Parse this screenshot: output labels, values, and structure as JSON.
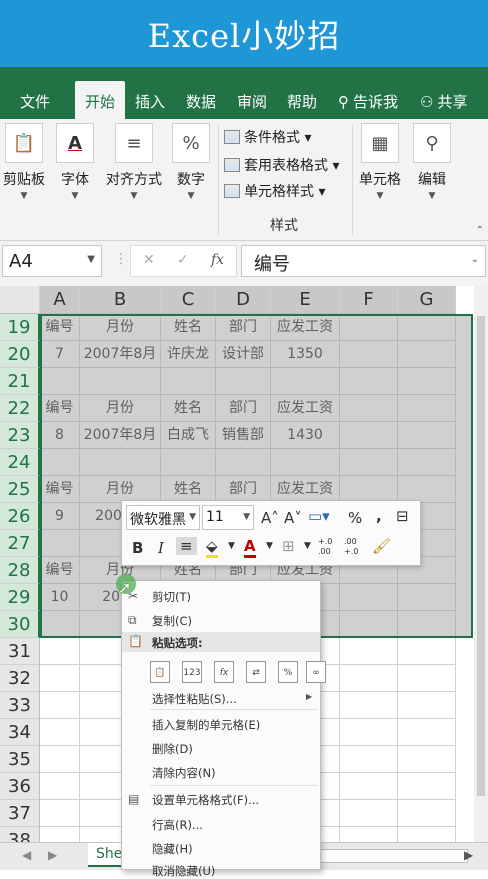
{
  "banner": {
    "title": "Excel小妙招"
  },
  "tabs": [
    {
      "label": "文件",
      "active": false
    },
    {
      "label": "开始",
      "active": true
    },
    {
      "label": "插入",
      "active": false
    },
    {
      "label": "数据",
      "active": false
    },
    {
      "label": "审阅",
      "active": false
    },
    {
      "label": "帮助",
      "active": false
    },
    {
      "label": "告诉我",
      "active": false,
      "icon": "search-icon"
    },
    {
      "label": "共享",
      "active": false,
      "icon": "person-icon"
    }
  ],
  "ribbon": {
    "clipboard": "剪贴板",
    "font": "字体",
    "alignment": "对齐方式",
    "number": "数字",
    "conditional_format": "条件格式",
    "table_format": "套用表格格式",
    "cell_styles": "单元格样式",
    "styles_group": "样式",
    "cells": "单元格",
    "editing": "编辑",
    "number_symbol": "%"
  },
  "formula_bar": {
    "name_box": "A4",
    "content": "编号",
    "fx": "fx"
  },
  "columns": [
    "A",
    "B",
    "C",
    "D",
    "E",
    "F",
    "G"
  ],
  "rows": [
    {
      "num": "19",
      "cells": [
        "编号",
        "月份",
        "姓名",
        "部门",
        "应发工资",
        "",
        ""
      ]
    },
    {
      "num": "20",
      "cells": [
        "7",
        "2007年8月",
        "许庆龙",
        "设计部",
        "1350",
        "",
        ""
      ]
    },
    {
      "num": "21",
      "cells": [
        "",
        "",
        "",
        "",
        "",
        "",
        ""
      ]
    },
    {
      "num": "22",
      "cells": [
        "编号",
        "月份",
        "姓名",
        "部门",
        "应发工资",
        "",
        ""
      ]
    },
    {
      "num": "23",
      "cells": [
        "8",
        "2007年8月",
        "白成飞",
        "销售部",
        "1430",
        "",
        ""
      ]
    },
    {
      "num": "24",
      "cells": [
        "",
        "",
        "",
        "",
        "",
        "",
        ""
      ]
    },
    {
      "num": "25",
      "cells": [
        "编号",
        "月份",
        "姓名",
        "部门",
        "应发工资",
        "",
        ""
      ]
    },
    {
      "num": "26",
      "cells": [
        "9",
        "2007年",
        "",
        "",
        "",
        "",
        ""
      ]
    },
    {
      "num": "27",
      "cells": [
        "",
        "",
        "",
        "",
        "",
        "",
        ""
      ]
    },
    {
      "num": "28",
      "cells": [
        "编号",
        "月份",
        "姓名",
        "部门",
        "应发工资",
        "",
        ""
      ]
    },
    {
      "num": "29",
      "cells": [
        "10",
        "2007",
        "",
        "",
        "",
        "",
        ""
      ]
    },
    {
      "num": "30",
      "cells": [
        "",
        "",
        "",
        "",
        "",
        "",
        ""
      ]
    },
    {
      "num": "31",
      "cells": [
        "",
        "",
        "",
        "",
        "",
        "",
        ""
      ]
    },
    {
      "num": "32",
      "cells": [
        "",
        "",
        "",
        "",
        "",
        "",
        ""
      ]
    },
    {
      "num": "33",
      "cells": [
        "",
        "",
        "",
        "",
        "",
        "",
        ""
      ]
    },
    {
      "num": "34",
      "cells": [
        "",
        "",
        "",
        "",
        "",
        "",
        ""
      ]
    },
    {
      "num": "35",
      "cells": [
        "",
        "",
        "",
        "",
        "",
        "",
        ""
      ]
    },
    {
      "num": "36",
      "cells": [
        "",
        "",
        "",
        "",
        "",
        "",
        ""
      ]
    },
    {
      "num": "37",
      "cells": [
        "",
        "",
        "",
        "",
        "",
        "",
        ""
      ]
    },
    {
      "num": "38",
      "cells": [
        "",
        "",
        "",
        "",
        "",
        "",
        ""
      ]
    }
  ],
  "mini_toolbar": {
    "font_name": "微软雅黑",
    "font_size": "11",
    "bold": "B",
    "italic": "I",
    "percent": "%",
    "comma": ",",
    "font_color_glyph": "A",
    "increase_font": "A",
    "decrease_font": "A",
    "increase_decimal": "+.0 .00",
    "decrease_decimal": ".00 +.0"
  },
  "context_menu": {
    "cut": "剪切(T)",
    "copy": "复制(C)",
    "paste_options": "粘贴选项:",
    "paste_special": "选择性粘贴(S)...",
    "insert_copied": "插入复制的单元格(E)",
    "delete": "删除(D)",
    "clear": "清除内容(N)",
    "format_cells": "设置单元格格式(F)...",
    "row_height": "行高(R)...",
    "hide": "隐藏(H)",
    "unhide": "取消隐藏(U)"
  },
  "sheet_tab": {
    "label": "She"
  }
}
